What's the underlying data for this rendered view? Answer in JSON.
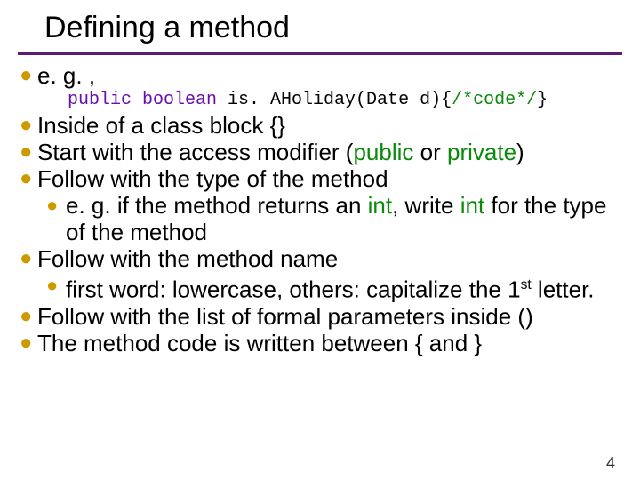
{
  "title": "Defining a method",
  "b1_label": "e. g. ,",
  "code_kw": "public boolean ",
  "code_body1": "is. AHoliday(Date d){",
  "code_cm": "/*code*/",
  "code_body2": "}",
  "b2": "Inside of a class block {}",
  "b3_a": "Start with the access modifier (",
  "b3_hl1": "public",
  "b3_b": " or ",
  "b3_hl2": "private",
  "b3_c": ")",
  "b4": "Follow with the type of the method",
  "b4s_a": "e. g. if the method returns an ",
  "b4s_hl1": "int",
  "b4s_b": ", write ",
  "b4s_hl2": "int",
  "b4s_c": " for the type of the method",
  "b5": "Follow with the method name",
  "b5s_a": "first word: lowercase, others: capitalize the 1",
  "b5s_sup": "st",
  "b5s_b": " letter.",
  "b6": "Follow with the list of formal parameters inside ()",
  "b7": "The method code is written between { and }",
  "page": "4"
}
